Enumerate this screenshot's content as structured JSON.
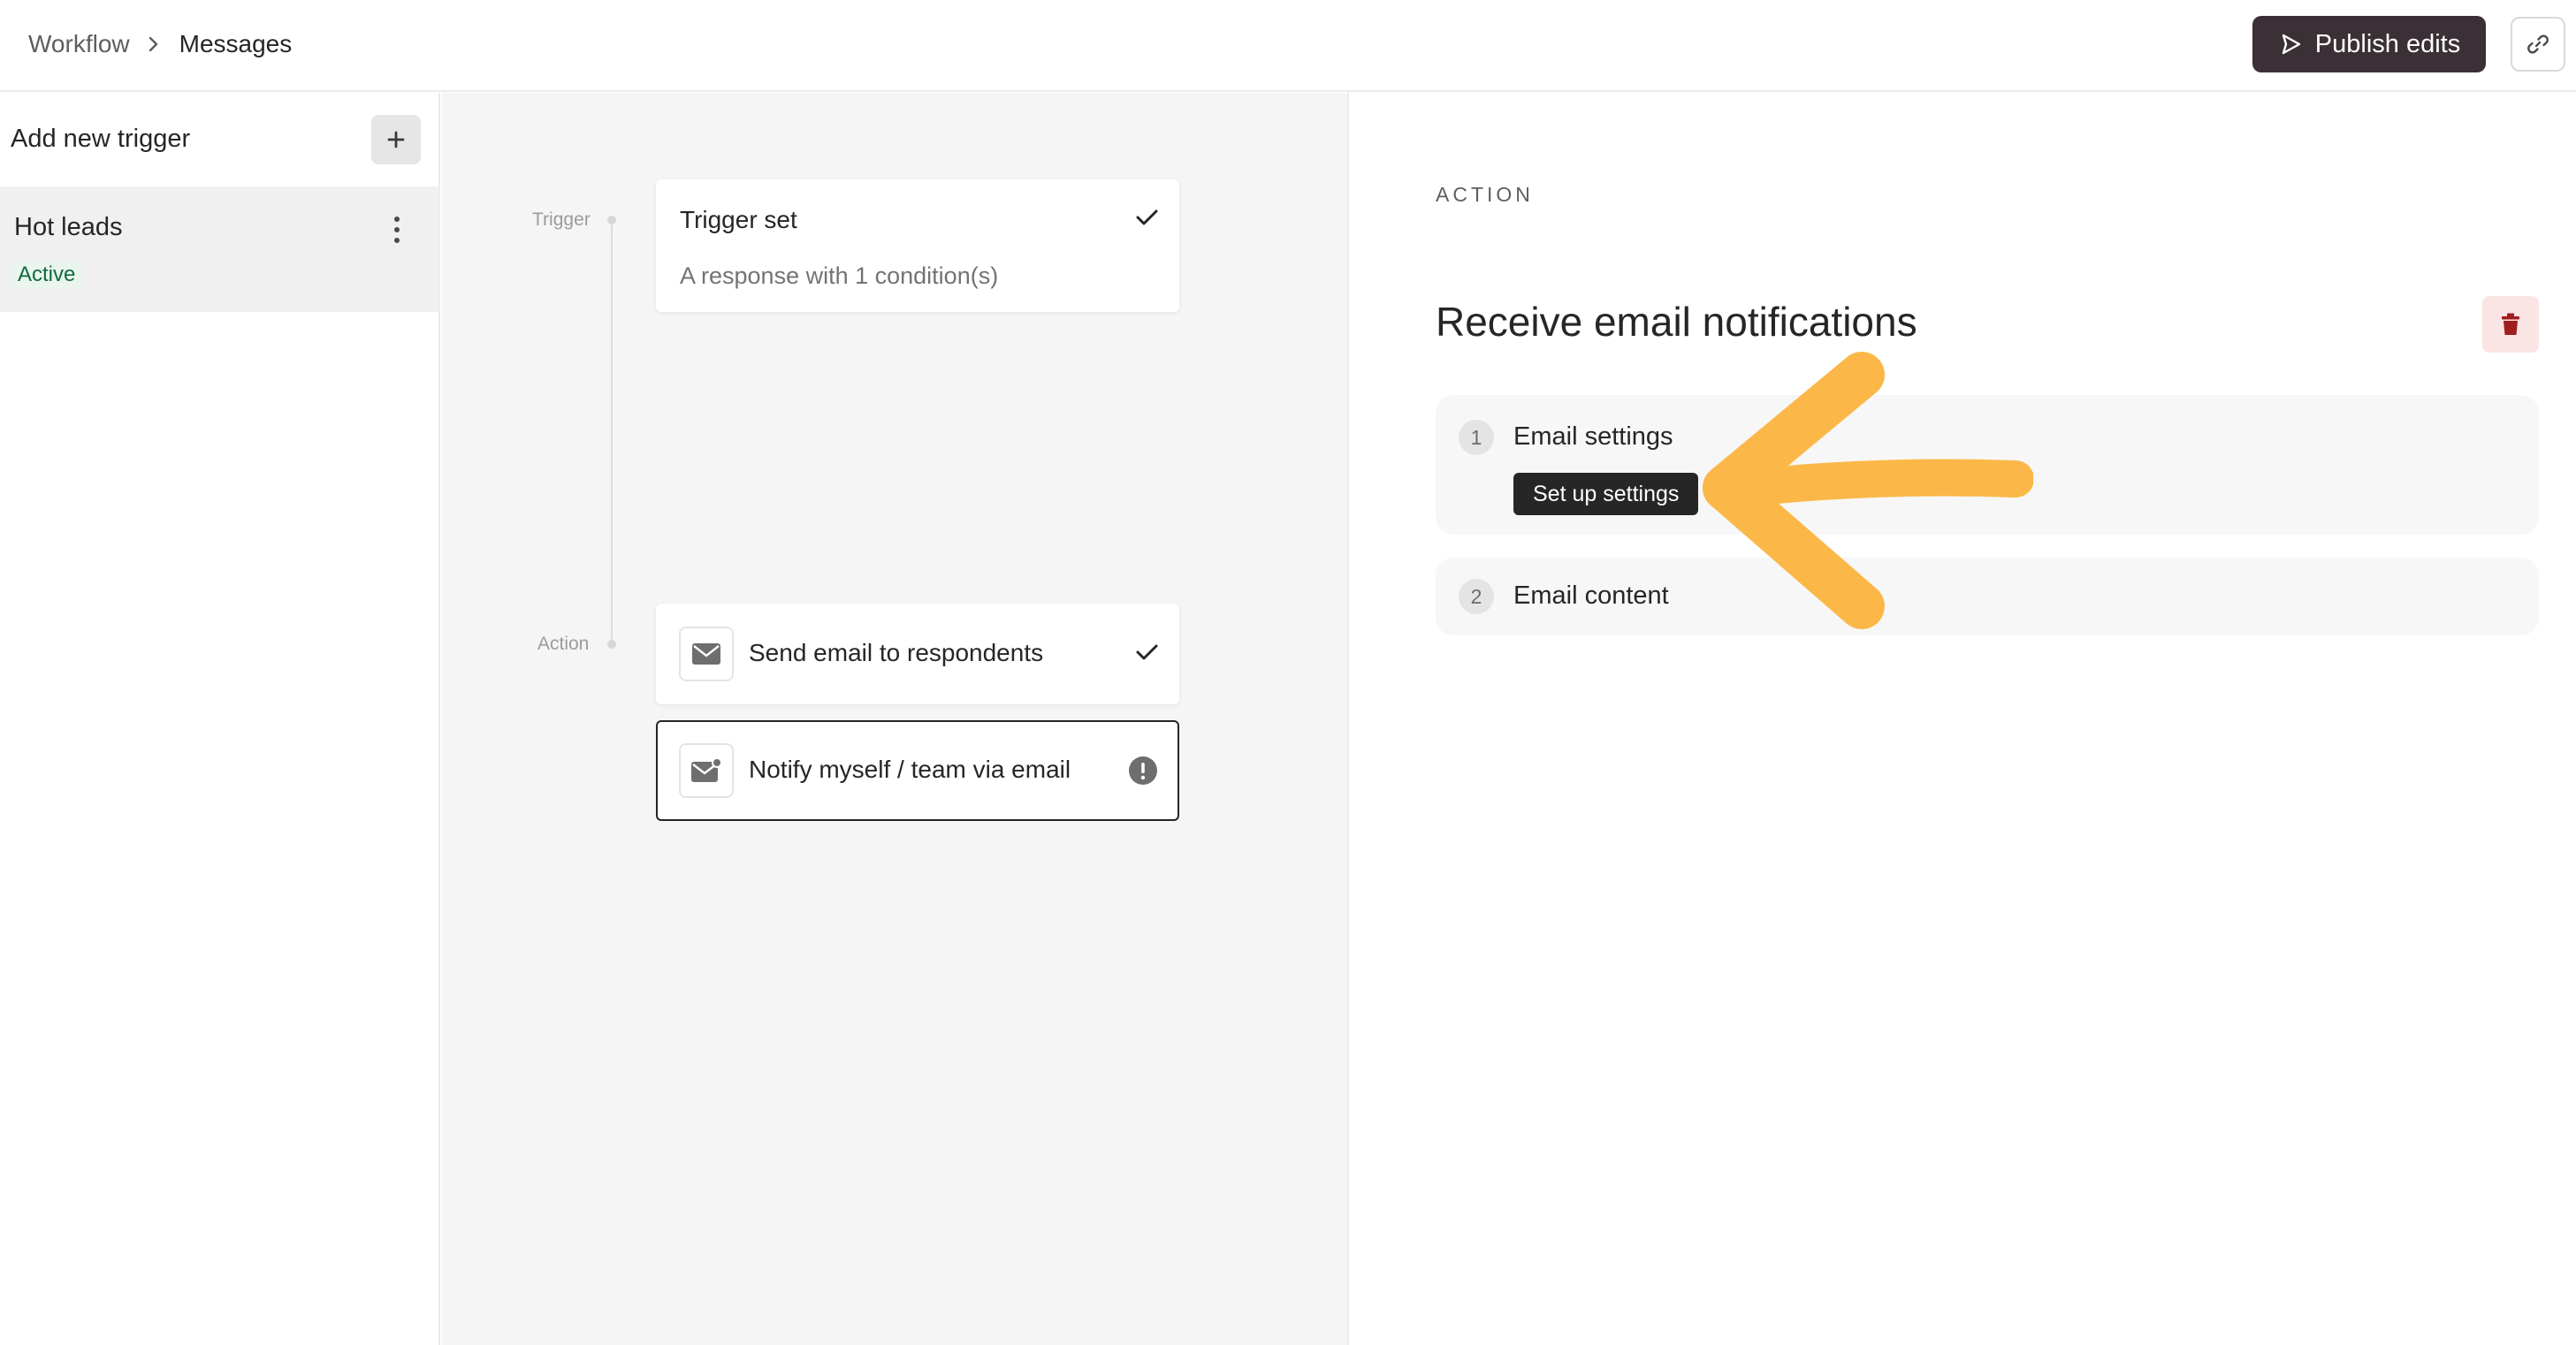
{
  "header": {
    "breadcrumb": [
      {
        "label": "Workflow"
      },
      {
        "label": "Messages"
      }
    ],
    "publish_label": "Publish edits",
    "icons": {
      "publish": "send-icon",
      "link": "link-icon",
      "separator": "chevron-right-icon"
    }
  },
  "sidebar": {
    "title": "Add new trigger",
    "triggers": [
      {
        "name": "Hot leads",
        "status": "Active"
      }
    ]
  },
  "canvas": {
    "timeline": {
      "trigger_label": "Trigger",
      "action_label": "Action"
    },
    "trigger_card": {
      "title": "Trigger set",
      "subtitle": "A response with 1 condition(s)",
      "status": "check-icon"
    },
    "actions": [
      {
        "title": "Send email to respondents",
        "icon": "mail-icon",
        "status": "check-icon"
      },
      {
        "title": "Notify myself / team via email",
        "icon": "mail-notify-icon",
        "status": "warning-icon"
      }
    ]
  },
  "panel": {
    "section_label": "ACTION",
    "title": "Receive email notifications",
    "steps": [
      {
        "number": "1",
        "title": "Email settings",
        "button": "Set up settings"
      },
      {
        "number": "2",
        "title": "Email content"
      }
    ]
  },
  "colors": {
    "primary_dark": "#3a3036",
    "active_green": "#0f6b3f",
    "delete_red": "#a01e1e",
    "arrow_annotation": "#fbb848"
  }
}
